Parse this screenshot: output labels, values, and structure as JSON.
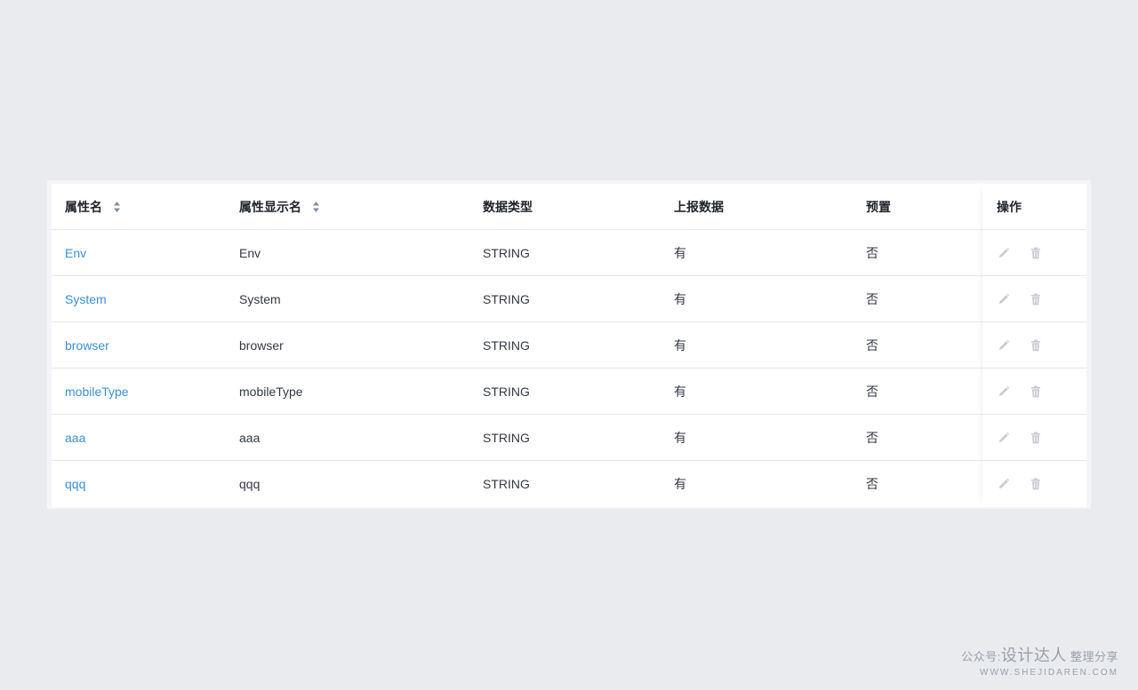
{
  "table": {
    "columns": [
      {
        "label": "属性名",
        "sortable": true
      },
      {
        "label": "属性显示名",
        "sortable": true
      },
      {
        "label": "数据类型",
        "sortable": false
      },
      {
        "label": "上报数据",
        "sortable": false
      },
      {
        "label": "预置",
        "sortable": false
      },
      {
        "label": "操作",
        "sortable": false
      }
    ],
    "rows": [
      {
        "name": "Env",
        "display_name": "Env",
        "data_type": "STRING",
        "reported": "有",
        "preset": "否"
      },
      {
        "name": "System",
        "display_name": "System",
        "data_type": "STRING",
        "reported": "有",
        "preset": "否"
      },
      {
        "name": "browser",
        "display_name": "browser",
        "data_type": "STRING",
        "reported": "有",
        "preset": "否"
      },
      {
        "name": "mobileType",
        "display_name": "mobileType",
        "data_type": "STRING",
        "reported": "有",
        "preset": "否"
      },
      {
        "name": "aaa",
        "display_name": "aaa",
        "data_type": "STRING",
        "reported": "有",
        "preset": "否"
      },
      {
        "name": "qqq",
        "display_name": "qqq",
        "data_type": "STRING",
        "reported": "有",
        "preset": "否"
      }
    ],
    "icons": {
      "sort": "sort-icon",
      "edit": "pencil-icon",
      "delete": "trash-icon"
    }
  },
  "colors": {
    "background": "#e9ebef",
    "link": "#3b8fd6",
    "icon_disabled": "#c9ccd1",
    "sort_icon": "#7f8ea3"
  },
  "watermark": {
    "prefix": "公众号:",
    "brand": "设计达人",
    "suffix": "整理分享",
    "url": "WWW.SHEJIDAREN.COM"
  }
}
